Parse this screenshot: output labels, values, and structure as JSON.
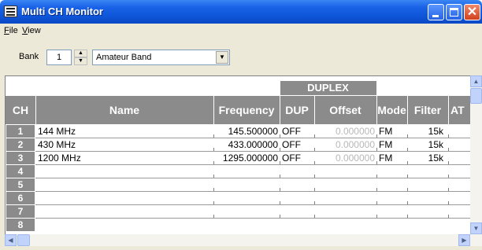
{
  "window": {
    "title": "Multi CH Monitor",
    "icon": "monitor-app-icon"
  },
  "menu": {
    "items": [
      {
        "accel": "F",
        "rest": "ile"
      },
      {
        "accel": "V",
        "rest": "iew"
      }
    ]
  },
  "bank": {
    "label": "Bank",
    "value": "1",
    "band": "Amateur Band"
  },
  "table": {
    "group_header": "DUPLEX",
    "columns": {
      "ch": "CH",
      "name": "Name",
      "frequency": "Frequency",
      "dup": "DUP",
      "offset": "Offset",
      "mode": "Mode",
      "filter": "Filter",
      "att": "AT"
    },
    "rows": [
      {
        "ch": "1",
        "name": "144 MHz",
        "frequency": "145.500000",
        "dup": "OFF",
        "offset": "0.000000",
        "mode": "FM",
        "filter": "15k"
      },
      {
        "ch": "2",
        "name": "430 MHz",
        "frequency": "433.000000",
        "dup": "OFF",
        "offset": "0.000000",
        "mode": "FM",
        "filter": "15k"
      },
      {
        "ch": "3",
        "name": "1200 MHz",
        "frequency": "1295.000000",
        "dup": "OFF",
        "offset": "0.000000",
        "mode": "FM",
        "filter": "15k"
      },
      {
        "ch": "4"
      },
      {
        "ch": "5"
      },
      {
        "ch": "6"
      },
      {
        "ch": "7"
      },
      {
        "ch": "8"
      }
    ]
  },
  "colors": {
    "titlebar": "#0e55d8",
    "header": "#8b8b8b",
    "frame": "#ece9d8"
  }
}
